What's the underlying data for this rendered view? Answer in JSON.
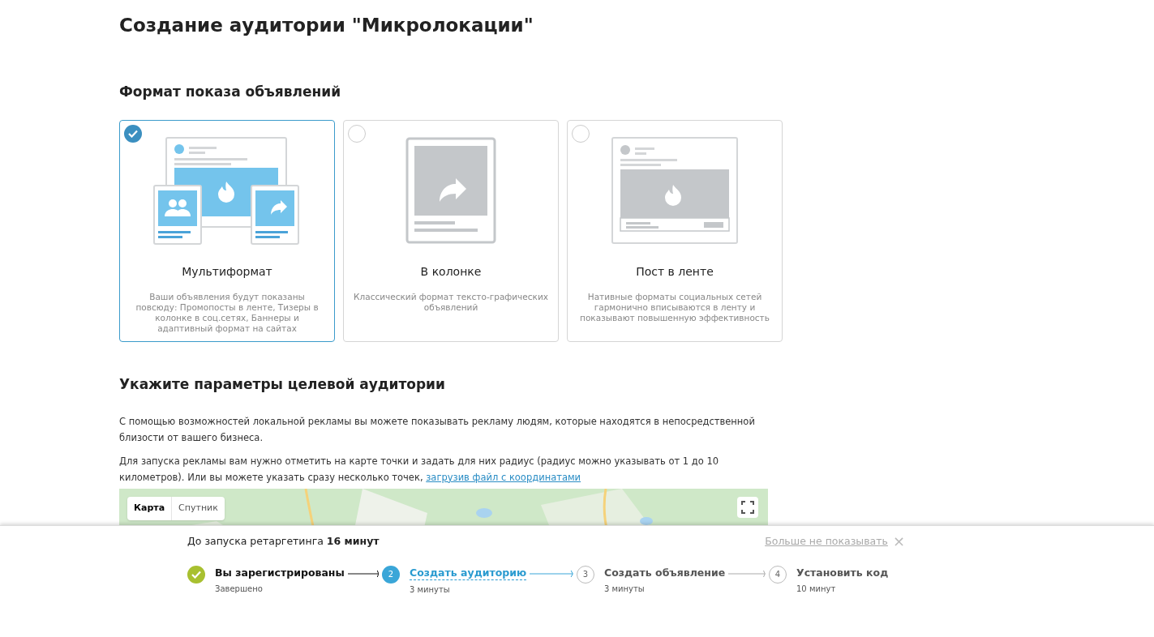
{
  "title": "Создание аудитории \"Микролокации\"",
  "format_section": {
    "heading": "Формат показа объявлений",
    "cards": [
      {
        "kind": "multi",
        "title": "Мультиформат",
        "description": "Ваши объявления будут показаны повсюду: Промопосты в ленте, Тизеры в колонке в соц.сетях, Баннеры и адаптивный формат на сайтах",
        "selected": true
      },
      {
        "kind": "column",
        "title": "В колонке",
        "description": "Классический формат тексто-графических объявлений",
        "selected": false
      },
      {
        "kind": "feed",
        "title": "Пост в ленте",
        "description": "Нативные форматы социальных сетей гармонично вписываются в ленту и показывают повышенную эффективность",
        "selected": false
      }
    ]
  },
  "audience_section": {
    "heading": "Укажите параметры целевой аудитории",
    "paragraphs": [
      "С помощью возможностей локальной рекламы вы можете показывать рекламу людям, которые находятся в непосредственной близости от вашего бизнеса.",
      "Для запуска рекламы вам нужно отметить на карте точки и задать для них радиус (радиус можно указывать от 1 до 10 километров). Или вы можете указать сразу несколько точек,"
    ],
    "link": "загрузив файл с координатами",
    "map": {
      "kind": "picture",
      "map_types": [
        {
          "label": "Карта",
          "selected": true
        },
        {
          "label": "Спутник",
          "selected": false
        }
      ]
    }
  },
  "onboarding": {
    "timer": "До запуска ретаргетинга **16 минут**",
    "dismiss": "Больше не показывать",
    "close": "×",
    "steps": [
      {
        "kind": "done",
        "title": "Вы зарегистрированы",
        "subtitle": "Завершено"
      },
      {
        "kind": "current",
        "marker": "2",
        "title": "Создать аудиторию",
        "subtitle": "3 минуты"
      },
      {
        "kind": "pending",
        "marker": "3",
        "title": "Создать объявление",
        "subtitle": "3 минуты"
      },
      {
        "kind": "pending",
        "marker": "4",
        "title": "Установить код",
        "subtitle": "10 минут"
      }
    ]
  }
}
